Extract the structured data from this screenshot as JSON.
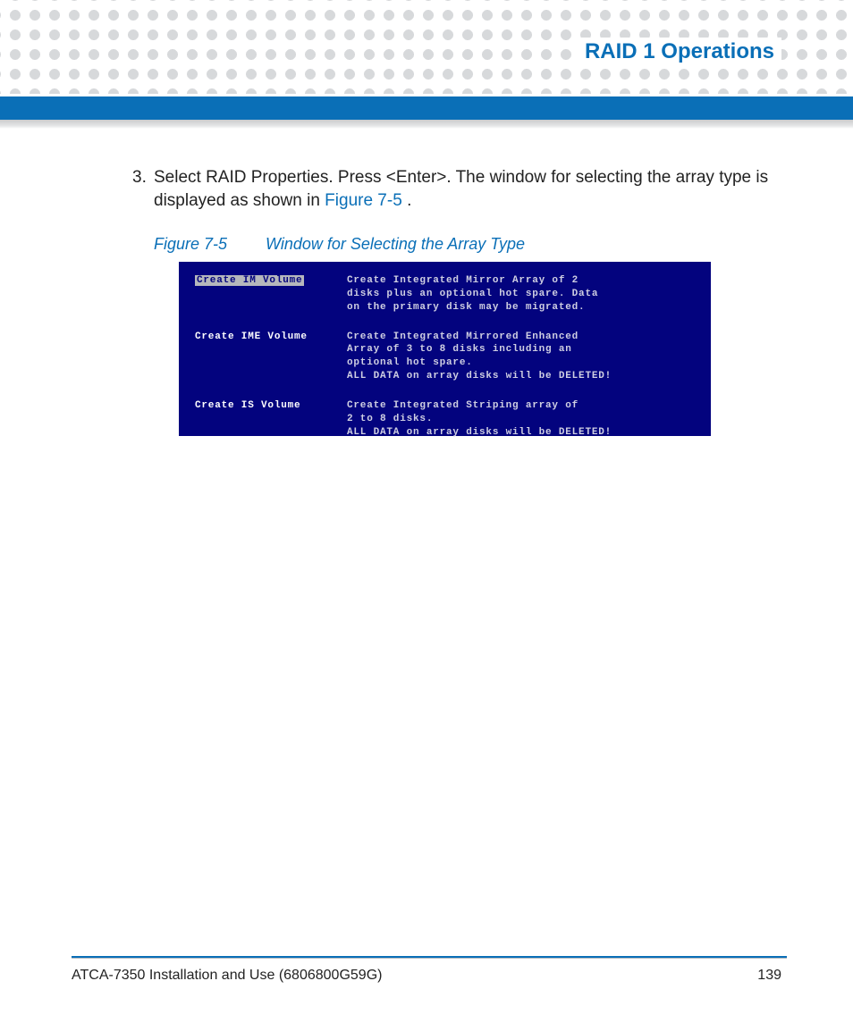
{
  "header": {
    "title": "RAID 1 Operations"
  },
  "step": {
    "number": "3.",
    "text_before_link": "Select RAID Properties. Press <Enter>. The window for selecting the array type is displayed as shown in ",
    "link": "Figure 7-5",
    "text_after_link": "."
  },
  "figure": {
    "num": "Figure 7-5",
    "caption": "Window for Selecting the Array Type"
  },
  "bios": {
    "options": [
      {
        "label": "Create IM Volume",
        "selected": true,
        "desc": "Create Integrated Mirror Array of 2\ndisks plus an optional hot spare. Data\non the primary disk may be migrated."
      },
      {
        "label": "Create IME Volume",
        "selected": false,
        "desc": "Create Integrated Mirrored Enhanced\nArray of 3 to 8 disks including an\noptional hot spare.\nALL DATA on array disks will be DELETED!"
      },
      {
        "label": "Create IS Volume",
        "selected": false,
        "desc": "Create Integrated Striping array of\n2 to 8 disks.\nALL DATA on array disks will be DELETED!"
      }
    ]
  },
  "footer": {
    "doc": "ATCA-7350 Installation and Use (6806800G59G)",
    "page": "139"
  }
}
